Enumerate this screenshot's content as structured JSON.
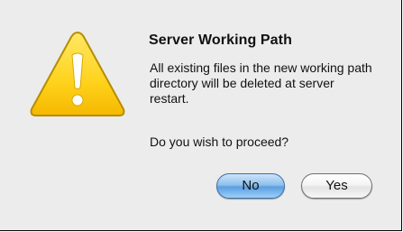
{
  "dialog": {
    "title": "Server Working Path",
    "message": "All existing files in the new working path directory will be deleted at server restart.",
    "question": "Do you wish to proceed?",
    "icon": "warning-icon",
    "buttons": {
      "no_label": "No",
      "yes_label": "Yes"
    }
  },
  "colors": {
    "icon_fill": "#ffd21c",
    "icon_outline": "#b68d00",
    "default_button": "#5b9fe0"
  }
}
